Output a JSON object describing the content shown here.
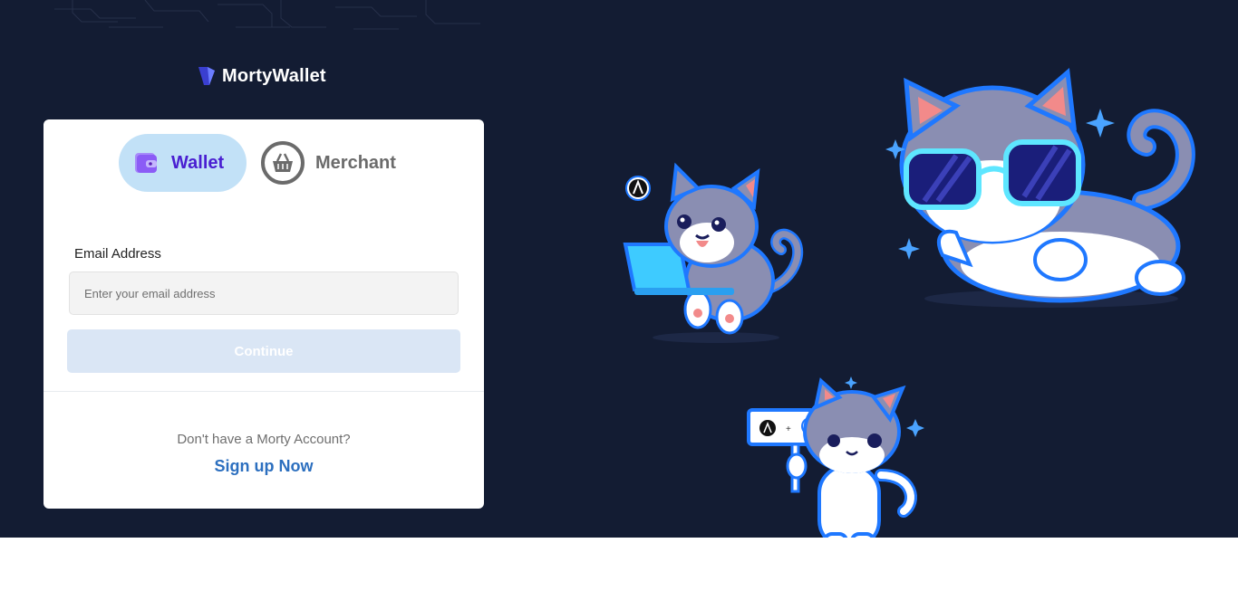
{
  "brand": {
    "name": "MortyWallet",
    "logo_icon": "morty-logo-icon"
  },
  "tabs": [
    {
      "label": "Wallet",
      "icon": "wallet-icon",
      "active": true
    },
    {
      "label": "Merchant",
      "icon": "basket-icon",
      "active": false
    }
  ],
  "form": {
    "email_label": "Email Address",
    "email_placeholder": "Enter your email address",
    "email_value": "",
    "continue_label": "Continue"
  },
  "signup": {
    "question": "Don't have a Morty Account?",
    "link_label": "Sign up Now"
  },
  "colors": {
    "hero_bg": "#131c33",
    "wallet_tab_bg": "#c2e1f7",
    "wallet_tab_text": "#4a1fd1",
    "link": "#2c6fbf",
    "button_disabled": "#dae6f5",
    "cat_body": "#8a8eb2",
    "cat_outline": "#1f78ff"
  }
}
